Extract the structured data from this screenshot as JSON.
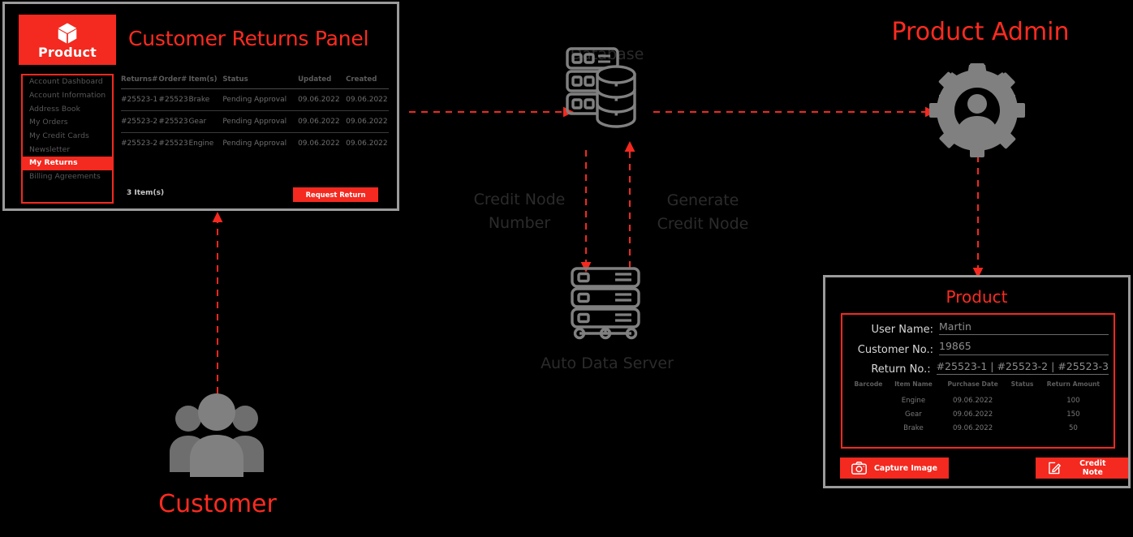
{
  "colors": {
    "accent_red": "#f4291f",
    "title_red": "#fd2b20",
    "icon_gray": "#808080",
    "label_gray": "#2b2b2b",
    "panel_border": "#9b9b9b",
    "background": "#000000"
  },
  "returns_panel": {
    "brand": "Product",
    "brand_icon": "cube-icon",
    "title": "Customer Returns Panel",
    "nav_items": [
      {
        "label": "Account Dashboard",
        "active": false
      },
      {
        "label": "Account Information",
        "active": false
      },
      {
        "label": "Address Book",
        "active": false
      },
      {
        "label": "My Orders",
        "active": false
      },
      {
        "label": "My Credit Cards",
        "active": false
      },
      {
        "label": "Newsletter",
        "active": false
      },
      {
        "label": "My Returns",
        "active": true
      },
      {
        "label": "Billing Agreements",
        "active": false
      }
    ],
    "table": {
      "headers": [
        "Returns#",
        "Order#",
        "Item(s)",
        "Status",
        "Updated",
        "Created"
      ],
      "rows": [
        [
          "#25523-1",
          "#25523",
          "Brake",
          "Pending Approval",
          "09.06.2022",
          "09.06.2022"
        ],
        [
          "#25523-2",
          "#25523",
          "Gear",
          "Pending Approval",
          "09.06.2022",
          "09.06.2022"
        ],
        [
          "#25523-2",
          "#25523",
          "Engine",
          "Pending Approval",
          "09.06.2022",
          "09.06.2022"
        ]
      ]
    },
    "item_count": "3 Item(s)",
    "request_return_label": "Request Return"
  },
  "center": {
    "database_label": "Database",
    "server_label": "Auto Data Server",
    "flow_credit_node_number": "Credit Node\nNumber",
    "flow_credit_node_number_line1": "Credit Node",
    "flow_credit_node_number_line2": "Number",
    "flow_generate_credit_node_line1": "Generate",
    "flow_generate_credit_node_line2": "Credit Node"
  },
  "product_admin": {
    "title": "Product Admin",
    "icon": "gear-user-icon"
  },
  "customer": {
    "label": "Customer",
    "icon": "people-group-icon"
  },
  "product_card": {
    "title": "Product",
    "fields": [
      {
        "label": "User Name:",
        "value": "Martin"
      },
      {
        "label": "Customer No.:",
        "value": "19865"
      },
      {
        "label": "Return No.:",
        "value": "#25523-1 | #25523-2 | #25523-3"
      }
    ],
    "table": {
      "headers": [
        "Barcode",
        "Item Name",
        "Purchase Date",
        "Status",
        "Return Amount"
      ],
      "rows": [
        [
          "",
          "Engine",
          "09.06.2022",
          "",
          "100"
        ],
        [
          "",
          "Gear",
          "09.06.2022",
          "",
          "150"
        ],
        [
          "",
          "Brake",
          "09.06.2022",
          "",
          "50"
        ]
      ]
    },
    "capture_image_label": "Capture Image",
    "capture_image_icon": "camera-icon",
    "credit_note_label": "Credit Note",
    "credit_note_icon": "pencil-edit-icon"
  }
}
